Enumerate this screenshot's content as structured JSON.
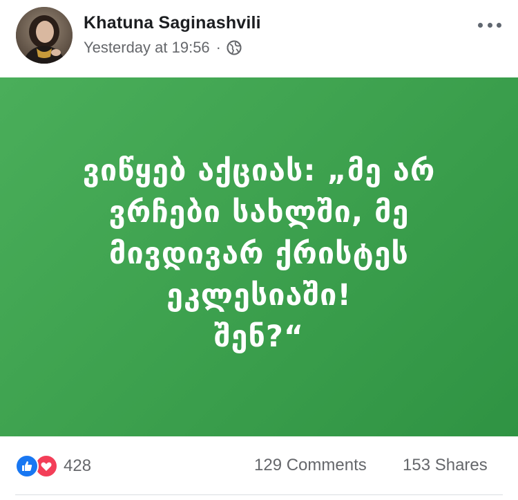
{
  "post": {
    "author": "Khatuna Saginashvili",
    "timestamp": "Yesterday at 19:56",
    "separator": "·",
    "privacy_icon": "globe-icon",
    "more_icon": "more-options-icon",
    "content": {
      "background_color": "#3ea24f",
      "text_color": "#ffffff",
      "lines": [
        "ვიწყებ აქციას: „მე არ",
        "ვრჩები სახლში, მე",
        "მივდივარ ქრისტეს",
        "ეკლესიაში!",
        "შენ?“"
      ]
    },
    "footer": {
      "reaction_icons": [
        "like-icon",
        "love-icon"
      ],
      "reaction_count": "428",
      "comments": "129 Comments",
      "shares": "153 Shares"
    }
  }
}
